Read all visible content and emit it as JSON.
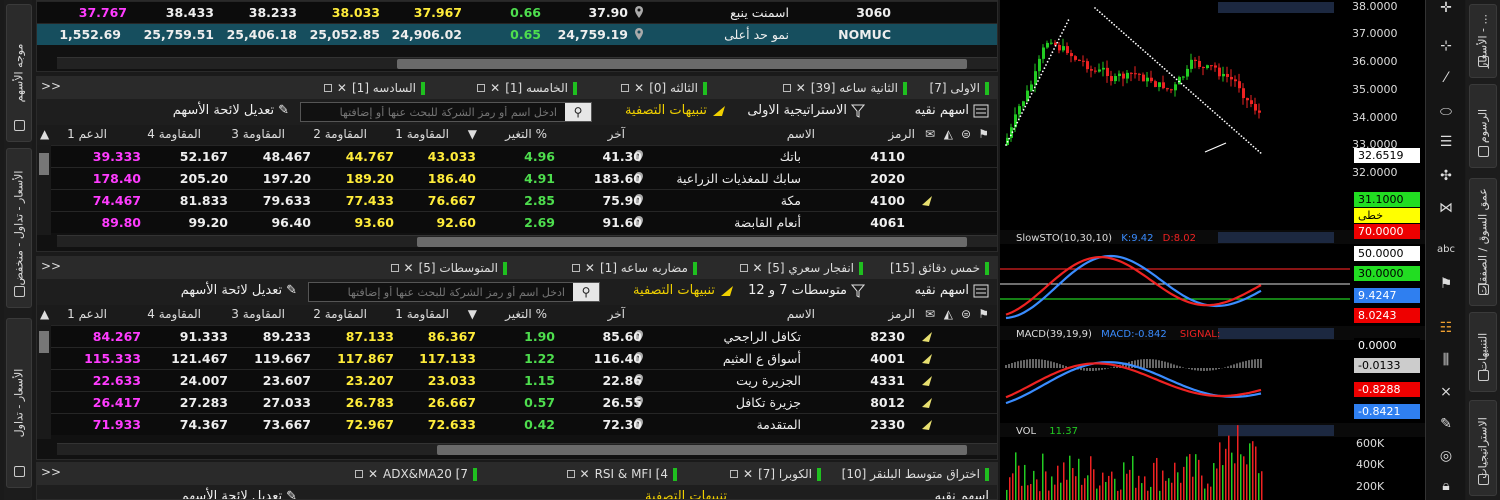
{
  "left_strip": {
    "tabs": [
      {
        "label": "موجه الأسهم"
      },
      {
        "label": "الأسعار - تداول - منخفض"
      },
      {
        "label": "الأسعار - تداول"
      }
    ]
  },
  "panel_top": {
    "rows": [
      {
        "code": "3060",
        "name": "اسمنت ينبع",
        "last": "37.90",
        "change": "0.66",
        "r1": "37.967",
        "r2": "38.033",
        "r3": "38.233",
        "r4": "38.433",
        "s1": "37.767"
      },
      {
        "code": "NOMUC",
        "name": "نمو حد أعلى",
        "last": "24,759.19",
        "change": "0.65",
        "r1": "24,906.02",
        "r2": "25,052.85",
        "r3": "25,406.18",
        "r4": "25,759.51",
        "s1": "1,552.69"
      }
    ]
  },
  "panel1": {
    "tabs": [
      "الاولى [7]",
      "الثانية ساعه [39]",
      "الثالثه [0]",
      "الخامسه [1]",
      "السادسه [1]"
    ],
    "toolbar": {
      "list_name": "اسهم نقيه",
      "strategy": "الاستراتيجية الاولى",
      "alerts": "تنبيهات التصفية",
      "search_placeholder": "ادخل اسم أو رمز الشركة للبحث عنها أو إضافتها",
      "edit": "تعديل لائحة الأسهم"
    },
    "headers": {
      "code": "الرمز",
      "name": "الاسم",
      "last": "آخر",
      "change": "التغير %",
      "r1": "المقاومة 1",
      "r2": "المقاومة 2",
      "r3": "المقاومة 3",
      "r4": "المقاومة 4",
      "s1": "الدعم 1"
    },
    "rows": [
      {
        "code": "4110",
        "name": "باتك",
        "last": "41.30",
        "change": "4.96",
        "r1": "43.033",
        "r2": "44.767",
        "r3": "48.467",
        "r4": "52.167",
        "s1": "39.333"
      },
      {
        "code": "2020",
        "name": "سابك للمغذيات الزراعية",
        "last": "183.60",
        "change": "4.91",
        "r1": "186.40",
        "r2": "189.20",
        "r3": "197.20",
        "r4": "205.20",
        "s1": "178.40"
      },
      {
        "code": "4100",
        "name": "مكة",
        "last": "75.90",
        "change": "2.85",
        "r1": "76.667",
        "r2": "77.433",
        "r3": "79.633",
        "r4": "81.833",
        "s1": "74.467"
      },
      {
        "code": "4061",
        "name": "أنعام القابضة",
        "last": "91.60",
        "change": "2.69",
        "r1": "92.60",
        "r2": "93.60",
        "r3": "96.40",
        "r4": "99.20",
        "s1": "89.80"
      }
    ]
  },
  "panel2": {
    "tabs": [
      "خمس دقائق [15]",
      "انفجار سعري [5]",
      "مضاربه ساعه [1]",
      "المتوسطات [5]"
    ],
    "toolbar": {
      "list_name": "اسهم نقيه",
      "strategy": "متوسطات 7 و 12",
      "alerts": "تنبيهات التصفية",
      "search_placeholder": "ادخل اسم أو رمز الشركة للبحث عنها أو إضافتها",
      "edit": "تعديل لائحة الأسهم"
    },
    "headers": {
      "code": "الرمز",
      "name": "الاسم",
      "last": "آخر",
      "change": "التغير %",
      "r1": "المقاومة 1",
      "r2": "المقاومة 2",
      "r3": "المقاومة 3",
      "r4": "المقاومة 4",
      "s1": "الدعم 1"
    },
    "rows": [
      {
        "code": "8230",
        "name": "تكافل الراجحي",
        "last": "85.60",
        "change": "1.90",
        "r1": "86.367",
        "r2": "87.133",
        "r3": "89.233",
        "r4": "91.333",
        "s1": "84.267"
      },
      {
        "code": "4001",
        "name": "أسواق ع العثيم",
        "last": "116.40",
        "change": "1.22",
        "r1": "117.133",
        "r2": "117.867",
        "r3": "119.667",
        "r4": "121.467",
        "s1": "115.333"
      },
      {
        "code": "4331",
        "name": "الجزيرة ريت",
        "last": "22.86",
        "change": "1.15",
        "r1": "23.033",
        "r2": "23.207",
        "r3": "23.607",
        "r4": "24.007",
        "s1": "22.633"
      },
      {
        "code": "8012",
        "name": "جزيرة تكافل",
        "last": "26.55",
        "change": "0.57",
        "r1": "26.667",
        "r2": "26.783",
        "r3": "27.033",
        "r4": "27.283",
        "s1": "26.417"
      },
      {
        "code": "2330",
        "name": "المتقدمة",
        "last": "72.30",
        "change": "0.42",
        "r1": "72.633",
        "r2": "72.967",
        "r3": "73.667",
        "r4": "74.367",
        "s1": "71.933"
      }
    ]
  },
  "panel3": {
    "tabs": [
      "اختراق متوسط البلنقر [10]",
      "الكوبرا [7]",
      "RSI & MFI [4",
      "ADX&MA20 [7"
    ],
    "toolbar": {
      "list_name": "اسهم نقيه",
      "alerts": "تنبيهات التصفية",
      "edit": "تعديل لائحة الأسهم"
    }
  },
  "chart": {
    "price_axis": [
      "38.0000",
      "37.0000",
      "36.0000",
      "35.0000",
      "34.0000",
      "33.0000",
      "32.0000"
    ],
    "price_tags": [
      {
        "text": "32.6519",
        "bg": "#ffffff",
        "fg": "#000000"
      },
      {
        "text": "31.1000",
        "bg": "#22dd22",
        "fg": "#000000"
      },
      {
        "text": "خطى",
        "bg": "#ffff00",
        "fg": "#000000"
      }
    ],
    "stoch": {
      "title": "SlowSTO(10,30,10)",
      "k": "K:9.42",
      "d": "D:8.02",
      "tags": [
        {
          "text": "70.0000",
          "bg": "#ee0000",
          "fg": "#ffffff"
        },
        {
          "text": "50.0000",
          "bg": "#ffffff",
          "fg": "#000000"
        },
        {
          "text": "30.0000",
          "bg": "#22dd22",
          "fg": "#000000"
        },
        {
          "text": "9.4247",
          "bg": "#2f7ff0",
          "fg": "#ffffff"
        },
        {
          "text": "8.0243",
          "bg": "#ee0000",
          "fg": "#ffffff"
        }
      ]
    },
    "macd": {
      "title": "MACD(39,19,9)",
      "macd": "MACD:-0.842",
      "signal": "SIGNAL:",
      "tags": [
        {
          "text": "0.0000",
          "bg": "#000000",
          "fg": "#ffffff"
        },
        {
          "text": "-0.0133",
          "bg": "#cccccc",
          "fg": "#000000"
        },
        {
          "text": "-0.8288",
          "bg": "#ee0000",
          "fg": "#ffffff"
        },
        {
          "text": "-0.8421",
          "bg": "#2f7ff0",
          "fg": "#ffffff"
        }
      ]
    },
    "vol": {
      "title": "VOL",
      "value": "11.37",
      "axis": [
        "600K",
        "400K",
        "200K"
      ]
    }
  },
  "right_strip": {
    "tabs": [
      {
        "label": "الأسعار - ..."
      },
      {
        "label": "الرسوم"
      },
      {
        "label": "عمق السوق / الصفقات"
      },
      {
        "label": "التنبيهات"
      },
      {
        "label": "الاستراتيجيات"
      }
    ]
  },
  "colors": {
    "green_change": "#4ede4e",
    "yellow_resistance": "#ffec3a",
    "magenta_support": "#ff3cff",
    "row_highlight": "#164e5e"
  }
}
